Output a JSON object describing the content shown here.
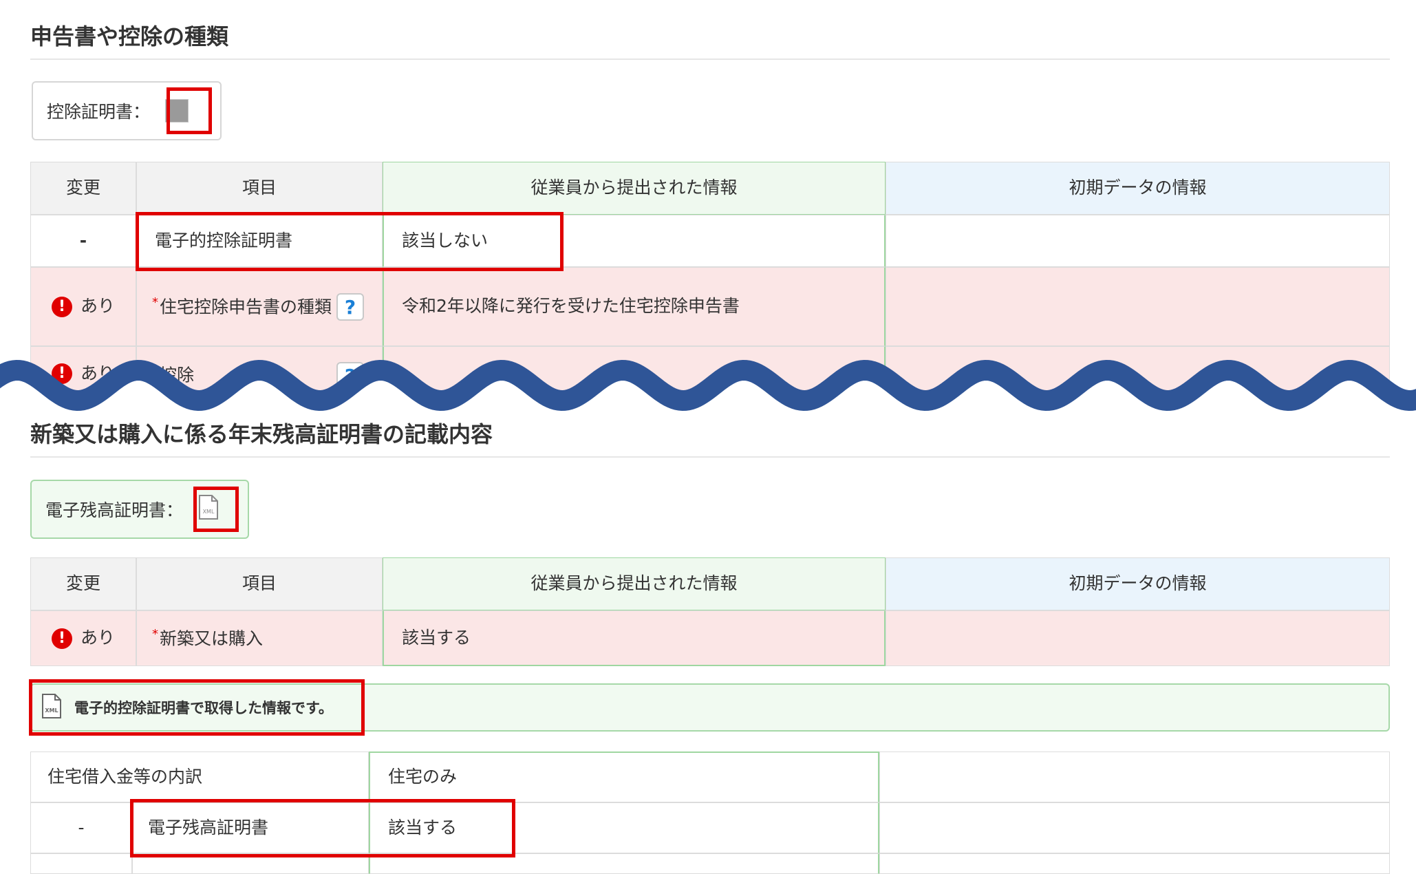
{
  "section1": {
    "title": "申告書や控除の種類",
    "certificate_label": "控除証明書：",
    "table": {
      "headers": [
        "変更",
        "項目",
        "従業員から提出された情報",
        "初期データの情報"
      ],
      "rows": [
        {
          "change": "-",
          "item": "電子的控除証明書",
          "submitted": "該当しない",
          "initial": ""
        },
        {
          "change": "あり",
          "item": "住宅控除申告書の種類",
          "submitted": "令和2年以降に発行を受けた住宅控除申告書",
          "initial": ""
        },
        {
          "change": "あり",
          "item": "控除",
          "submitted": "",
          "initial": ""
        }
      ]
    }
  },
  "section2": {
    "title": "新築又は購入に係る年末残高証明書の記載内容",
    "certificate_label": "電子残高証明書：",
    "table": {
      "headers": [
        "変更",
        "項目",
        "従業員から提出された情報",
        "初期データの情報"
      ],
      "rows": [
        {
          "change": "あり",
          "item": "新築又は購入",
          "submitted": "該当する",
          "initial": ""
        }
      ]
    },
    "notice_text": "電子的控除証明書で取得した情報です。",
    "detail_rows": [
      {
        "label": "住宅借入金等の内訳",
        "value": "住宅のみ",
        "initial": ""
      },
      {
        "change": "-",
        "label": "電子残高証明書",
        "value": "該当する",
        "initial": ""
      }
    ]
  },
  "icons": {
    "alert": "exclamation-circle-icon",
    "help": "question-mark-icon",
    "xml_file": "xml-file-icon",
    "thumbnail": "certificate-thumbnail-icon"
  },
  "colors": {
    "highlight_red": "#e00000",
    "wave_blue": "#2f5597",
    "pink_row": "#fbe6e6",
    "green_header": "#eff9ef",
    "blue_header": "#eaf4fc"
  }
}
